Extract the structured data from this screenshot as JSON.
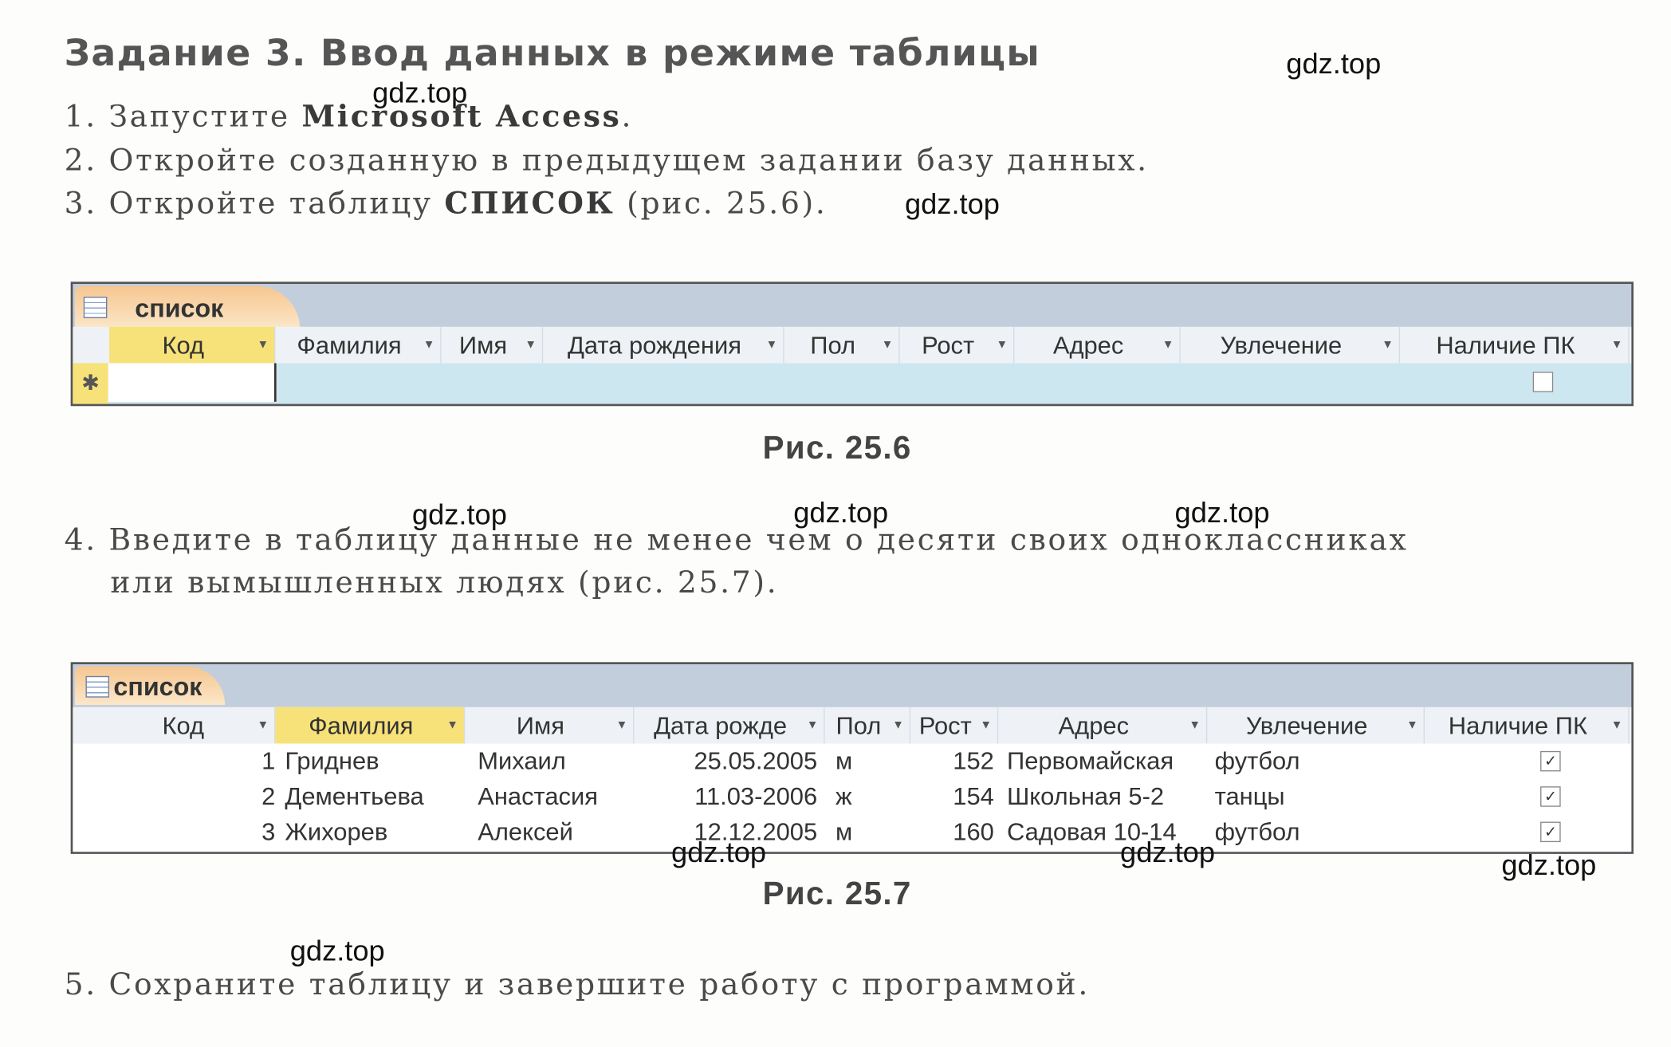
{
  "title": "Задание 3. Ввод данных в режиме таблицы",
  "steps": {
    "s1_text": "1. Запустите ",
    "s1_bold": "Microsoft Access",
    "s2": "2. Откройте созданную в предыдущем задании базу данных.",
    "s3_text": "3. Откройте таблицу ",
    "s3_bold": "СПИСОК",
    "s3_tail": " (рис. 25.6).",
    "s4_line1": "4. Введите в таблицу данные не менее чем о десяти своих одноклассниках",
    "s4_line2": "или вымышленных людях (рис. 25.7).",
    "s5": "5. Сохраните таблицу и завершите работу с программой."
  },
  "fig1": {
    "caption": "Рис. 25.6",
    "tab_label": "список",
    "columns": [
      "Код",
      "Фамилия",
      "Имя",
      "Дата рождения",
      "Пол",
      "Рост",
      "Адрес",
      "Увлечение",
      "Наличие ПК"
    ],
    "new_row_marker": "✱",
    "new_row_checkbox": false
  },
  "fig2": {
    "caption": "Рис. 25.7",
    "tab_label": "список",
    "columns": [
      "Код",
      "Фамилия",
      "Имя",
      "Дата рожде",
      "Пол",
      "Рост",
      "Адрес",
      "Увлечение",
      "Наличие ПК"
    ],
    "rows": [
      {
        "kod": "1",
        "familiya": "Гриднев",
        "imya": "Михаил",
        "data": "25.05.2005",
        "pol": "м",
        "rost": "152",
        "adres": "Первомайская",
        "uvl": "футбол",
        "pk": true
      },
      {
        "kod": "2",
        "familiya": "Дементьева",
        "imya": "Анастасия",
        "data": "11.03-2006",
        "pol": "ж",
        "rost": "154",
        "adres": "Школьная 5-2",
        "uvl": "танцы",
        "pk": true
      },
      {
        "kod": "3",
        "familiya": "Жихорев",
        "imya": "Алексей",
        "data": "12.12.2005",
        "pol": "м",
        "rost": "160",
        "adres": "Садовая 10-14",
        "uvl": "футбол",
        "pk": true
      }
    ]
  },
  "watermark": "gdz.top",
  "colors": {
    "selected_header": "#f7e27a",
    "tab": "#f6c690",
    "new_row": "#cde7f0"
  }
}
